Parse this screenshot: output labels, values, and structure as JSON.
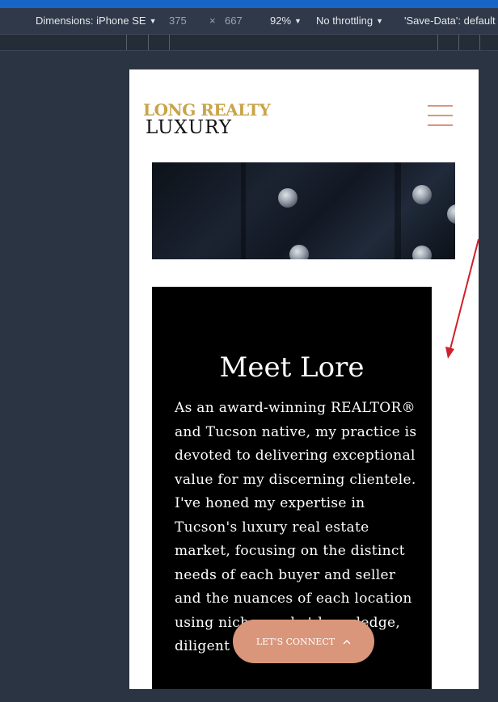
{
  "devtools": {
    "dimensions_label": "Dimensions: iPhone SE",
    "width": "375",
    "times": "×",
    "height": "667",
    "zoom": "92%",
    "throttling": "No throttling",
    "save_data": "'Save-Data': default"
  },
  "site": {
    "logo_top": "LONG REALTY",
    "logo_bottom": "LUXURY"
  },
  "card": {
    "title": "Meet Lore",
    "body": "As an award-winning REALTOR® and Tucson native, my practice is devoted to delivering exceptional value for my discerning clientele. I've honed my expertise in Tucson's luxury real estate market, focusing on the distinct needs of each buyer and seller and the nuances of each location using niche market knowledge, diligent"
  },
  "cta": {
    "label": "LET'S CONNECT"
  },
  "colors": {
    "accent": "#d9967a",
    "logo_gold": "#c9a449",
    "annotation_arrow": "#d0202a"
  },
  "icons": [
    "menu-icon",
    "chevron-up-icon",
    "caret-down-icon"
  ]
}
